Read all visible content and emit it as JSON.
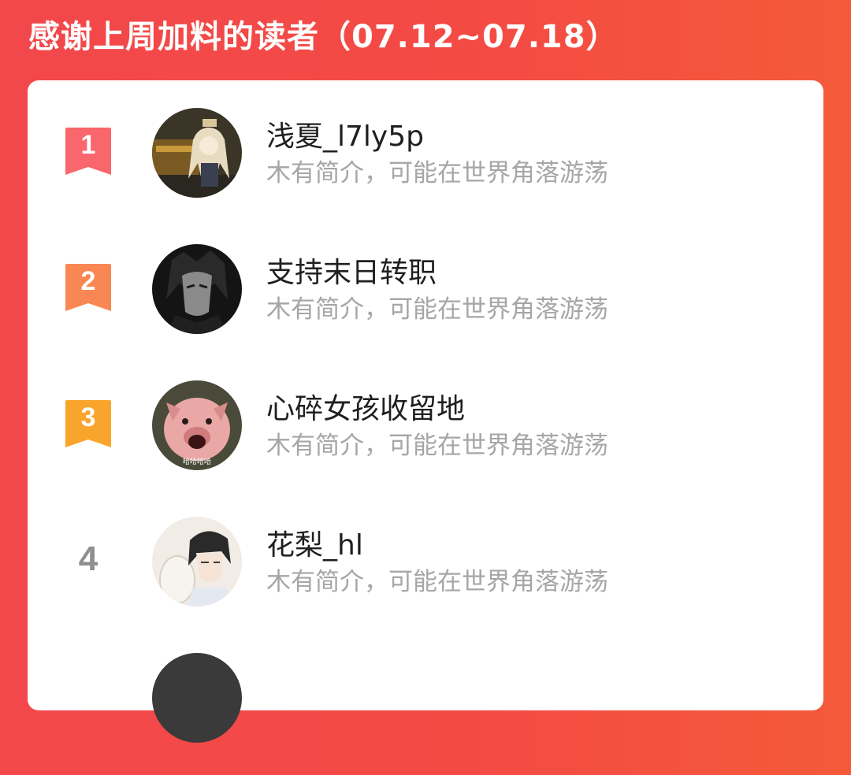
{
  "header": {
    "title": "感谢上周加料的读者（07.12~07.18）"
  },
  "colors": {
    "rank1": "#f9666b",
    "rank2": "#f98754",
    "rank3": "#f9a52c",
    "rank_plain": "#8f8f8f"
  },
  "readers": [
    {
      "rank": "1",
      "name": "浅夏_l7ly5p",
      "bio": "木有简介，可能在世界角落游荡",
      "avatar_icon": "anime-girl-avatar"
    },
    {
      "rank": "2",
      "name": "支持末日转职",
      "bio": "木有简介，可能在世界角落游荡",
      "avatar_icon": "dark-character-avatar"
    },
    {
      "rank": "3",
      "name": "心碎女孩收留地",
      "bio": "木有简介，可能在世界角落游荡",
      "avatar_icon": "pig-avatar",
      "avatar_caption": "哈哈哈哈"
    },
    {
      "rank": "4",
      "name": "花梨_hl",
      "bio": "木有简介，可能在世界角落游荡",
      "avatar_icon": "anime-boy-avatar"
    }
  ]
}
